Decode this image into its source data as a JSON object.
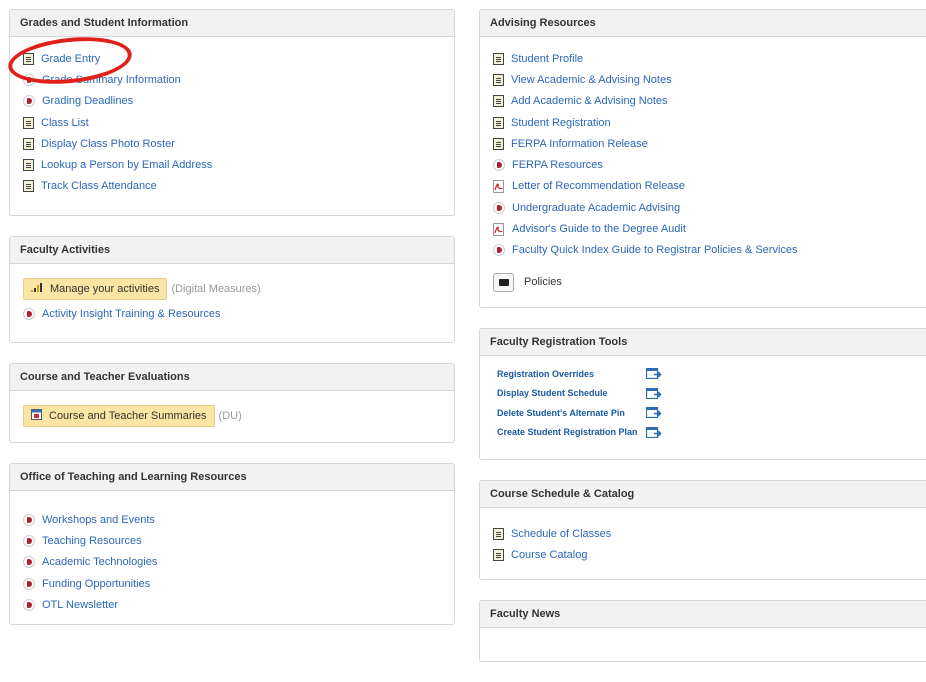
{
  "left": {
    "grades": {
      "title": "Grades and Student Information",
      "items": [
        {
          "label": "Grade Entry",
          "icon": "document-icon"
        },
        {
          "label": "Grade Summary Information",
          "icon": "web-icon"
        },
        {
          "label": "Grading Deadlines",
          "icon": "web-icon"
        },
        {
          "label": "Class List",
          "icon": "document-icon"
        },
        {
          "label": "Display Class Photo Roster",
          "icon": "document-icon"
        },
        {
          "label": "Lookup a Person by Email Address",
          "icon": "document-icon"
        },
        {
          "label": "Track Class Attendance",
          "icon": "document-icon"
        }
      ]
    },
    "faculty_activities": {
      "title": "Faculty Activities",
      "button": "Manage your activities",
      "button_note": "(Digital Measures)",
      "items": [
        {
          "label": "Activity Insight Training & Resources",
          "icon": "web-icon"
        }
      ]
    },
    "evaluations": {
      "title": "Course and Teacher Evaluations",
      "button": "Course and Teacher Summaries",
      "button_note": "(DU)"
    },
    "otl": {
      "title": "Office of Teaching and Learning Resources",
      "items": [
        {
          "label": "Workshops and Events",
          "icon": "web-icon"
        },
        {
          "label": "Teaching Resources",
          "icon": "web-icon"
        },
        {
          "label": "Academic Technologies",
          "icon": "web-icon"
        },
        {
          "label": "Funding Opportunities",
          "icon": "web-icon"
        },
        {
          "label": "OTL Newsletter",
          "icon": "web-icon"
        }
      ]
    }
  },
  "right": {
    "advising": {
      "title": "Advising Resources",
      "items": [
        {
          "label": "Student Profile",
          "icon": "document-icon"
        },
        {
          "label": "View Academic & Advising Notes",
          "icon": "document-icon"
        },
        {
          "label": "Add Academic & Advising Notes",
          "icon": "document-icon"
        },
        {
          "label": "Student Registration",
          "icon": "document-icon"
        },
        {
          "label": "FERPA Information Release",
          "icon": "document-icon"
        },
        {
          "label": "FERPA Resources",
          "icon": "web-icon"
        },
        {
          "label": "Letter of Recommendation Release",
          "icon": "pdf-icon"
        },
        {
          "label": "Undergraduate Academic Advising",
          "icon": "web-icon"
        },
        {
          "label": "Advisor's Guide to the Degree Audit",
          "icon": "pdf-icon"
        },
        {
          "label": "Faculty Quick Index Guide to Registrar Policies & Services",
          "icon": "web-icon"
        }
      ],
      "policies": "Policies"
    },
    "registration_tools": {
      "title": "Faculty Registration Tools",
      "items": [
        {
          "label": "Registration Overrides"
        },
        {
          "label": "Display Student Schedule"
        },
        {
          "label": "Delete Student's Alternate Pin"
        },
        {
          "label": "Create Student Registration Plan"
        }
      ]
    },
    "schedule": {
      "title": "Course Schedule & Catalog",
      "items": [
        {
          "label": "Schedule of Classes",
          "icon": "document-icon"
        },
        {
          "label": "Course Catalog",
          "icon": "document-icon"
        }
      ]
    },
    "news": {
      "title": "Faculty News"
    }
  },
  "colors": {
    "link": "#2b68b6",
    "panel_header_bg": "#f2f2f2",
    "button_bg": "#fbe5a5",
    "annotation": "#e0201b"
  }
}
